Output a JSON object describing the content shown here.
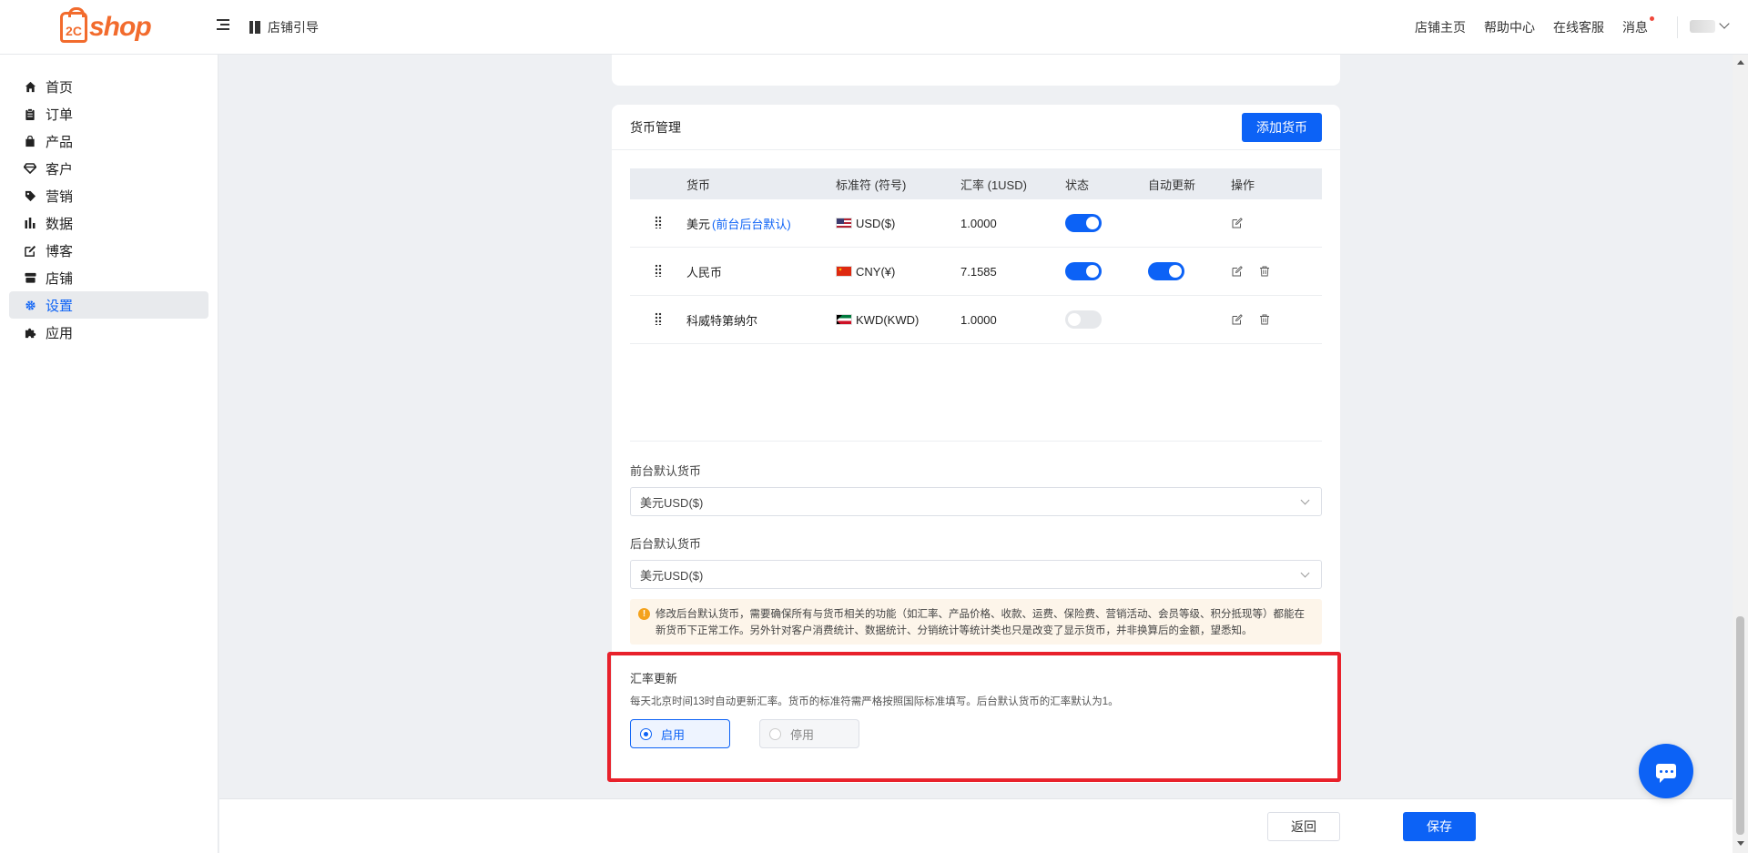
{
  "brand": {
    "logo_mark": "2C",
    "logo_text": "shop"
  },
  "header": {
    "guide_label": "店铺引导",
    "links": [
      "店铺主页",
      "帮助中心",
      "在线客服",
      "消息"
    ]
  },
  "sidebar": {
    "items": [
      {
        "label": "首页",
        "icon": "home-icon"
      },
      {
        "label": "订单",
        "icon": "clipboard-icon"
      },
      {
        "label": "产品",
        "icon": "bag-icon"
      },
      {
        "label": "客户",
        "icon": "diamond-icon"
      },
      {
        "label": "营销",
        "icon": "tag-icon"
      },
      {
        "label": "数据",
        "icon": "bar-chart-icon"
      },
      {
        "label": "博客",
        "icon": "edit-icon"
      },
      {
        "label": "店铺",
        "icon": "store-icon"
      },
      {
        "label": "设置",
        "icon": "gear-icon",
        "active": true
      },
      {
        "label": "应用",
        "icon": "puzzle-icon"
      }
    ]
  },
  "currency": {
    "title": "货币管理",
    "add_button": "添加货币",
    "columns": [
      "货币",
      "标准符 (符号)",
      "汇率 (1USD)",
      "状态",
      "自动更新",
      "操作"
    ],
    "rows": [
      {
        "name": "美元",
        "default_tag": "(前台后台默认)",
        "flag": "us-flag-icon",
        "code": "USD($)",
        "rate": "1.0000",
        "status": true,
        "auto_update": null,
        "deletable": false
      },
      {
        "name": "人民币",
        "default_tag": "",
        "flag": "cn-flag-icon",
        "code": "CNY(¥)",
        "rate": "7.1585",
        "status": true,
        "auto_update": true,
        "deletable": true
      },
      {
        "name": "科威特第纳尔",
        "default_tag": "",
        "flag": "kw-flag-icon",
        "code": "KWD(KWD)",
        "rate": "1.0000",
        "status": false,
        "auto_update": null,
        "deletable": true
      }
    ],
    "front_default_label": "前台默认货币",
    "front_default_value": "美元USD($)",
    "back_default_label": "后台默认货币",
    "back_default_value": "美元USD($)",
    "warning": "修改后台默认货币，需要确保所有与货币相关的功能（如汇率、产品价格、收款、运费、保险费、营销活动、会员等级、积分抵现等）都能在新货币下正常工作。另外针对客户消费统计、数据统计、分销统计等统计类也只是改变了显示货币，并非换算后的金额，望悉知。"
  },
  "rate_update": {
    "title": "汇率更新",
    "description": "每天北京时间13时自动更新汇率。货币的标准符需严格按照国际标准填写。后台默认货币的汇率默认为1。",
    "options": [
      {
        "label": "启用",
        "selected": true
      },
      {
        "label": "停用",
        "selected": false
      }
    ]
  },
  "footer": {
    "save_label": "保存",
    "back_label": "返回"
  },
  "colors": {
    "primary": "#0c62f6",
    "brand": "#f26b2d",
    "highlight": "#e8212b"
  }
}
